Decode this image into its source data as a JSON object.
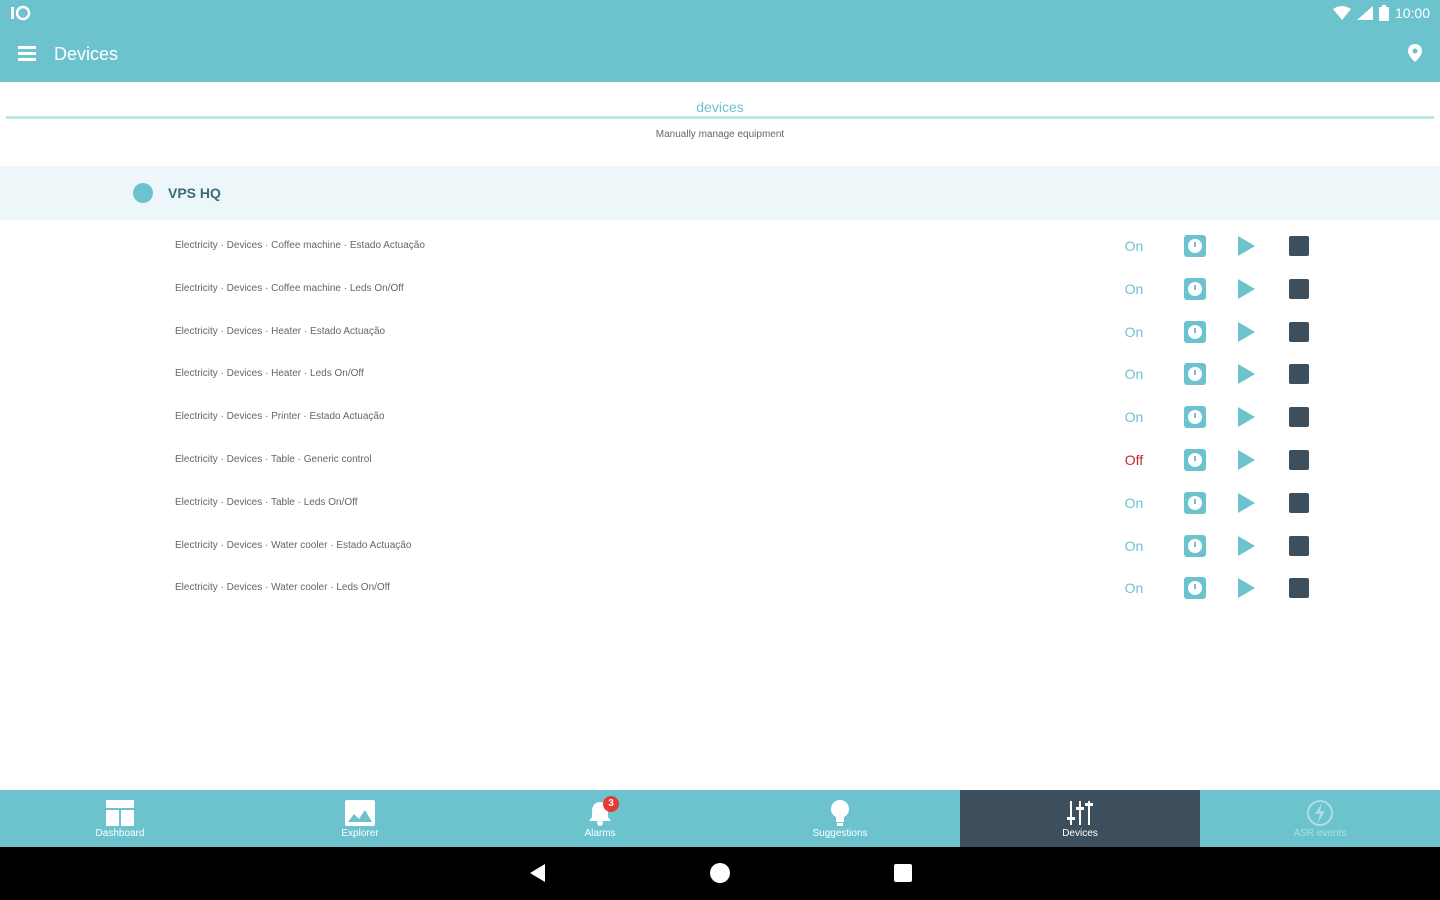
{
  "status_bar": {
    "left_icon": "data-saver-icon",
    "time": "10:00"
  },
  "app_bar": {
    "title": "Devices"
  },
  "section": {
    "title": "devices",
    "subtitle": "Manually manage equipment"
  },
  "group": {
    "name": "VPS HQ"
  },
  "devices": [
    {
      "label": "Electricity · Devices · Coffee machine · Estado Actuação",
      "status": "On"
    },
    {
      "label": "Electricity · Devices · Coffee machine · Leds On/Off",
      "status": "On"
    },
    {
      "label": "Electricity · Devices · Heater · Estado Actuação",
      "status": "On"
    },
    {
      "label": "Electricity · Devices · Heater · Leds On/Off",
      "status": "On"
    },
    {
      "label": "Electricity · Devices · Printer · Estado Actuação",
      "status": "On"
    },
    {
      "label": "Electricity · Devices · Table · Generic control",
      "status": "Off"
    },
    {
      "label": "Electricity · Devices · Table · Leds On/Off",
      "status": "On"
    },
    {
      "label": "Electricity · Devices · Water cooler · Estado Actuação",
      "status": "On"
    },
    {
      "label": "Electricity · Devices · Water cooler · Leds On/Off",
      "status": "On"
    }
  ],
  "tabs": [
    {
      "label": "Dashboard",
      "icon": "dashboard-icon"
    },
    {
      "label": "Explorer",
      "icon": "explorer-icon"
    },
    {
      "label": "Alarms",
      "icon": "bell-icon",
      "badge": "3"
    },
    {
      "label": "Suggestions",
      "icon": "lightbulb-icon"
    },
    {
      "label": "Devices",
      "icon": "sliders-icon",
      "active": true
    },
    {
      "label": "ASR events",
      "icon": "bolt-icon",
      "disabled": true
    }
  ],
  "colors": {
    "primary": "#6cc3ce",
    "dark": "#3d4f5c",
    "off": "#c62828",
    "group_bg": "#edf7f9"
  }
}
